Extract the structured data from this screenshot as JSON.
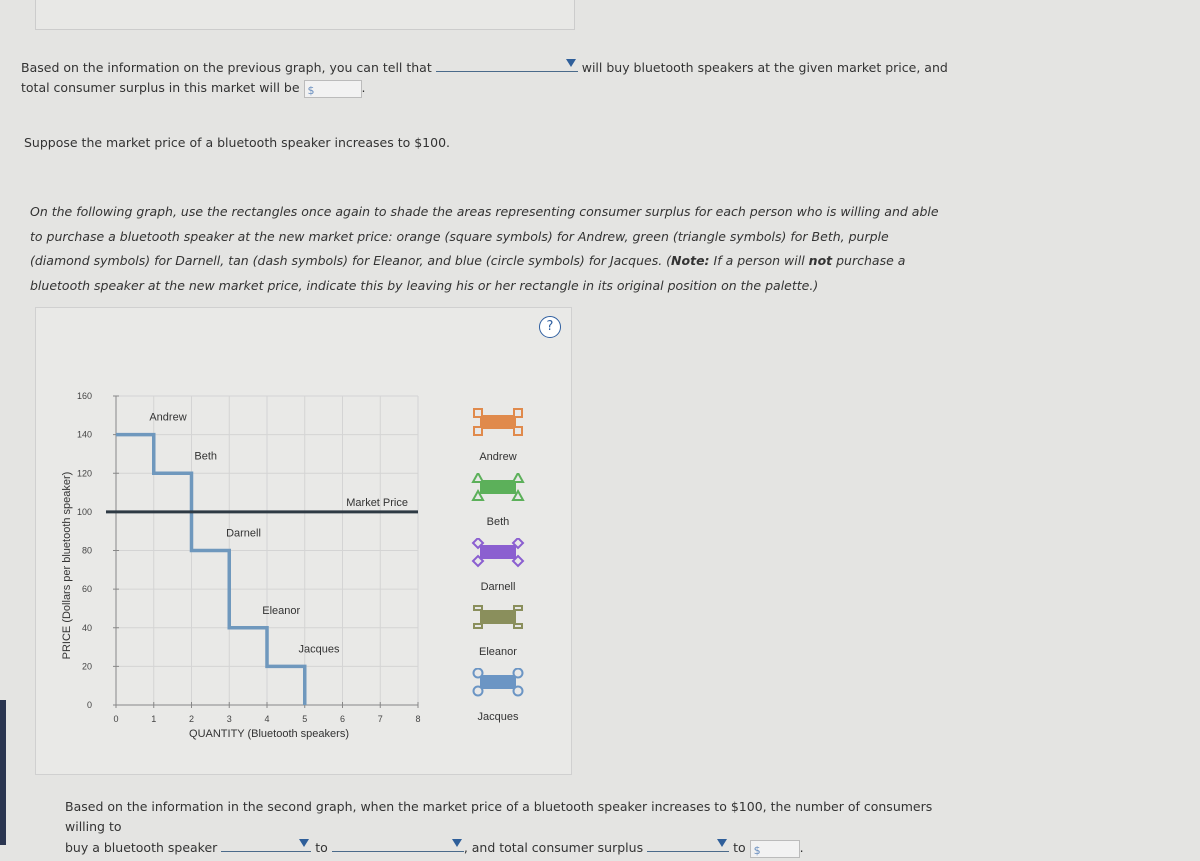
{
  "question1": {
    "text_before": "Based on the information on the previous graph, you can tell that",
    "text_after": "will buy bluetooth speakers at the given market price, and",
    "line2": "total consumer surplus in this market will be",
    "currency": "$",
    "end": "."
  },
  "scenario": "Suppose the market price of a bluetooth speaker increases to $100.",
  "instructions": {
    "part1": "On the following graph, use the rectangles once again to shade the areas representing consumer surplus for each person who is willing and able to purchase a bluetooth speaker at the new market price: orange (square symbols) for Andrew, green (triangle symbols) for Beth, purple (diamond symbols) for Darnell, tan (dash symbols) for Eleanor, and blue (circle symbols) for Jacques. (",
    "note_label": "Note:",
    "part2": " If a person will ",
    "not": "not",
    "part3": " purchase a bluetooth speaker at the new market price, indicate this by leaving his or her rectangle in its original position on the palette.)"
  },
  "help_label": "?",
  "chart_data": {
    "type": "line",
    "xlabel": "QUANTITY (Bluetooth speakers)",
    "ylabel": "PRICE (Dollars per bluetooth speaker)",
    "xlim": [
      0,
      8
    ],
    "ylim": [
      0,
      160
    ],
    "xticks": [
      "0",
      "1",
      "2",
      "3",
      "4",
      "5",
      "6",
      "7",
      "8"
    ],
    "yticks": [
      "0",
      "20",
      "40",
      "60",
      "80",
      "100",
      "120",
      "140",
      "160"
    ],
    "grid": true,
    "demand_steps": [
      {
        "name": "Andrew",
        "from": 0,
        "to": 1,
        "price": 140
      },
      {
        "name": "Beth",
        "from": 1,
        "to": 2,
        "price": 120
      },
      {
        "name": "Darnell",
        "from": 2,
        "to": 3,
        "price": 80
      },
      {
        "name": "Eleanor",
        "from": 3,
        "to": 4,
        "price": 40
      },
      {
        "name": "Jacques",
        "from": 4,
        "to": 5,
        "price": 20
      }
    ],
    "market_price": {
      "label": "Market Price",
      "value": 100
    },
    "demand_color": "#6f98bd"
  },
  "palette": [
    {
      "name": "Andrew",
      "color": "#e08a4c",
      "symbol": "square"
    },
    {
      "name": "Beth",
      "color": "#5cb05a",
      "symbol": "triangle"
    },
    {
      "name": "Darnell",
      "color": "#8b5fd0",
      "symbol": "diamond"
    },
    {
      "name": "Eleanor",
      "color": "#8a8f5c",
      "symbol": "dash"
    },
    {
      "name": "Jacques",
      "color": "#6b95c4",
      "symbol": "circle"
    }
  ],
  "question2": {
    "line1": "Based on the information in the second graph, when the market price of a bluetooth speaker increases to $100, the number of consumers willing to",
    "line2a": "buy a bluetooth speaker",
    "to1": "to",
    "mid": ", and total consumer surplus",
    "to2": "to",
    "currency": "$",
    "end": "."
  }
}
